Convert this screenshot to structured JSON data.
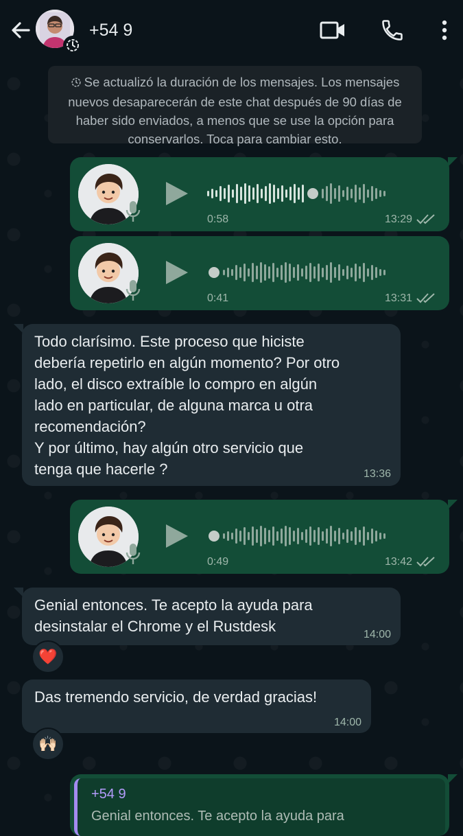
{
  "header": {
    "contact_name": "+54 9",
    "icons": [
      "back-arrow-icon",
      "avatar",
      "disappearing-timer-icon",
      "video-call-icon",
      "phone-icon",
      "more-options-icon"
    ]
  },
  "notice": {
    "text": "Se actualizó la duración de los mensajes. Los mensajes nuevos desaparecerán de este chat después de 90 días de haber sido enviados, a menos que se use la opción para conservarlos. Toca para cambiar esto."
  },
  "messages": [
    {
      "type": "voice",
      "direction": "out",
      "duration": "0:58",
      "time": "13:29",
      "progress": 0.6
    },
    {
      "type": "voice",
      "direction": "out",
      "duration": "0:41",
      "time": "13:31",
      "progress": 0.0
    },
    {
      "type": "text",
      "direction": "in",
      "text": "Todo clarísimo. Este proceso que hiciste\ndebería repetirlo en algún momento? Por otro\nlado, el disco extraíble lo compro en algún\nlado en particular, de alguna marca u otra\nrecomendación?\nY por último, hay algún otro servicio que\ntenga que hacerle ?",
      "time": "13:36"
    },
    {
      "type": "voice",
      "direction": "out",
      "duration": "0:49",
      "time": "13:42",
      "progress": 0.0
    },
    {
      "type": "text",
      "direction": "in",
      "text": "Genial entonces. Te acepto la ayuda para\ndesinstalar el Chrome y el Rustdesk",
      "time": "14:00",
      "reaction": "❤️"
    },
    {
      "type": "text",
      "direction": "in",
      "text": "Das tremendo servicio, de verdad gracias!",
      "time": "14:00",
      "reaction": "🙌🏻"
    }
  ],
  "quoted_reply": {
    "name": "+54 9",
    "text": "Genial entonces. Te acepto la ayuda para"
  },
  "colors": {
    "background": "#0b141a",
    "outgoing_bubble": "#134d37",
    "incoming_bubble": "#1f2c34",
    "read_ticks": "#9fb7ab",
    "quote_accent": "#a38bf0"
  }
}
